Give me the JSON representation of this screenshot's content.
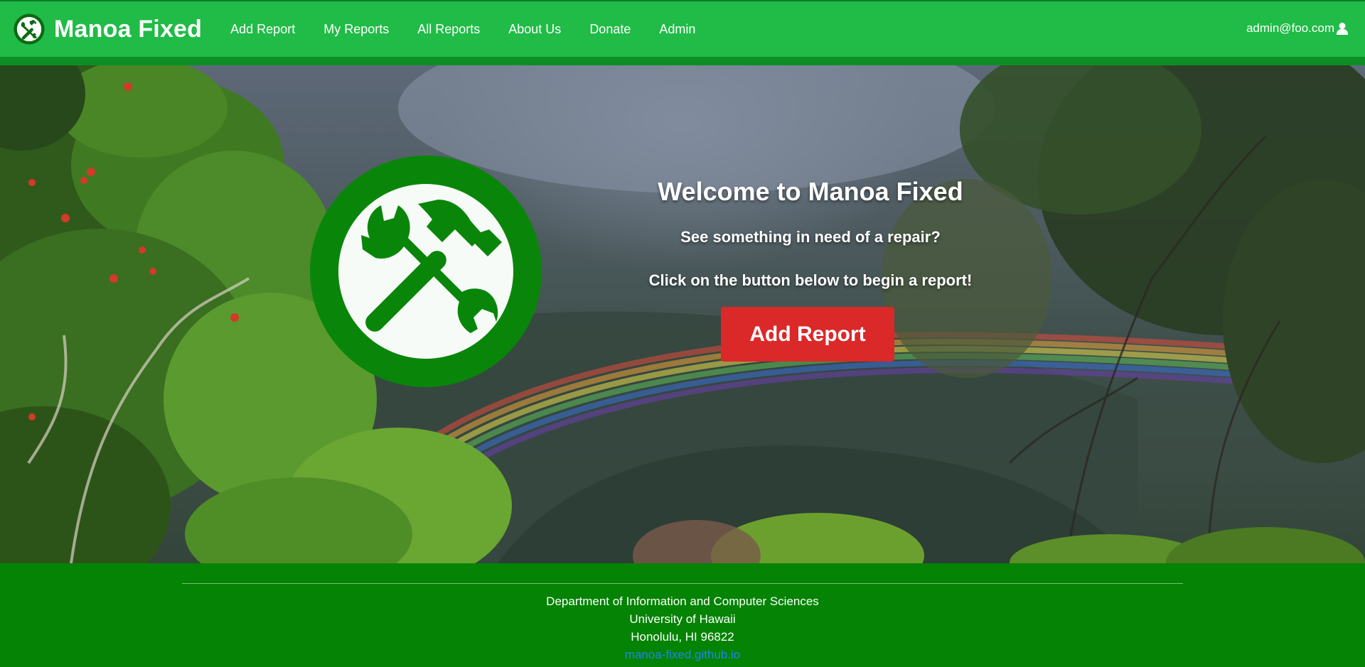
{
  "brand": {
    "name": "Manoa Fixed"
  },
  "nav": {
    "links": [
      "Add Report",
      "My Reports",
      "All Reports",
      "About Us",
      "Donate",
      "Admin"
    ],
    "user_email": "admin@foo.com"
  },
  "hero": {
    "title": "Welcome to Manoa Fixed",
    "subtitle_1": "See something in need of a repair?",
    "subtitle_2": "Click on the button below to begin a report!",
    "button_label": "Add Report"
  },
  "footer": {
    "line_1": "Department of Information and Computer Sciences",
    "line_2": "University of Hawaii",
    "line_3": "Honolulu, HI 96822",
    "link_text": "manoa-fixed.github.io"
  },
  "colors": {
    "navbar": "#21bb47",
    "footer": "#048304",
    "logo_green": "#098609",
    "button_red": "#db2828",
    "link_blue": "#1e88e5"
  },
  "icons": {
    "brand_logo": "hammer-wrench-icon",
    "user": "user-icon"
  }
}
